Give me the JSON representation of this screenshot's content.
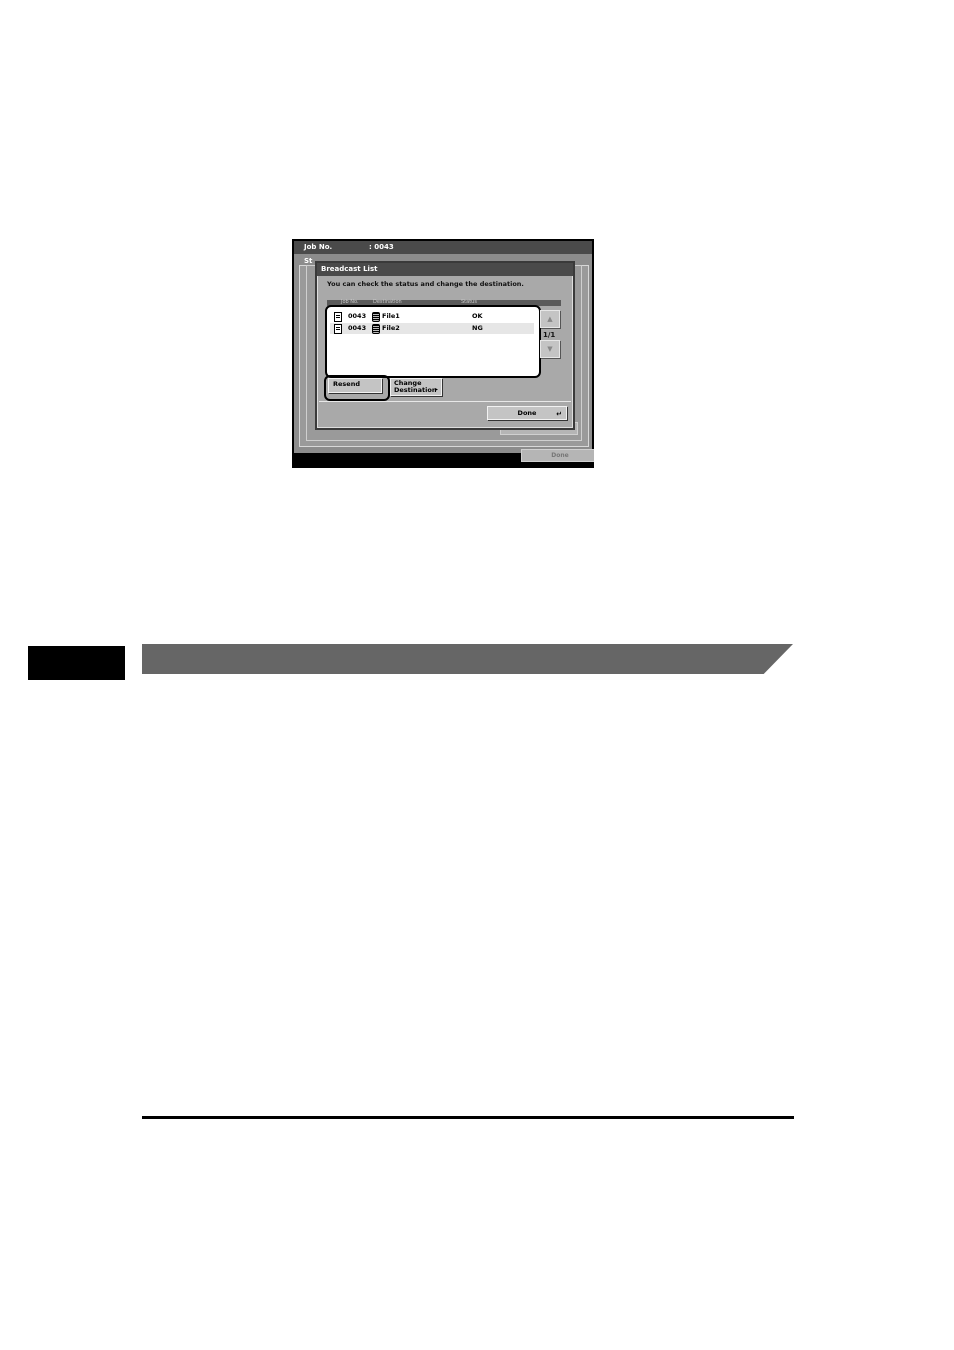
{
  "screen": {
    "header": {
      "job_label": "Job No.",
      "job_value": ": 0043",
      "status_cut": "St"
    },
    "background_done_1": "Done",
    "background_done_2": "Done"
  },
  "dialog": {
    "title": "Breadcast List",
    "message": "You can check the status and change the destination.",
    "columns": [
      "Job No.",
      "Destination",
      "Status"
    ],
    "rows": [
      {
        "job": "0043",
        "destination": "File1",
        "status": "OK"
      },
      {
        "job": "0043",
        "destination": "File2",
        "status": "NG"
      }
    ],
    "page_indicator": "1/1",
    "resend_label": "Resend",
    "change_label_1": "Change",
    "change_label_2": "Destination",
    "done_label": "Done",
    "scroll_up_icon": "triangle-up-icon",
    "scroll_down_icon": "triangle-down-icon"
  }
}
